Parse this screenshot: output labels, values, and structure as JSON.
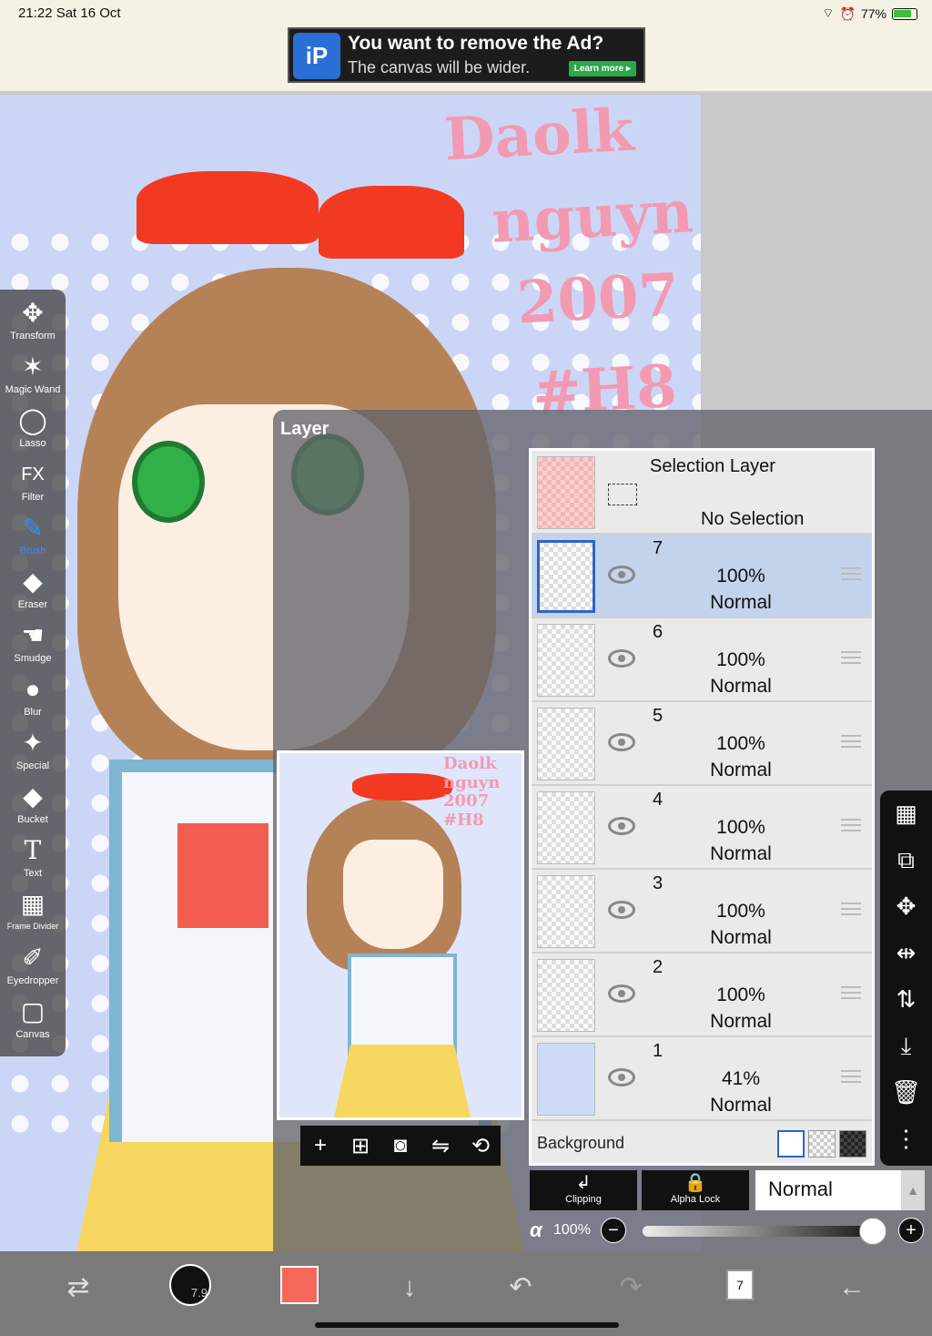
{
  "status_bar": {
    "time_date": "21:22  Sat 16 Oct",
    "battery": "77%"
  },
  "ad": {
    "logo": "iP",
    "headline": "You want to remove the Ad?",
    "subline": "The canvas will be wider.",
    "button": "Learn more ▸"
  },
  "canvas": {
    "signature": [
      "Daolk",
      "nguyn",
      "2007",
      "#H8"
    ]
  },
  "toolbar": {
    "tools": [
      {
        "label": "Transform",
        "icon": "✥"
      },
      {
        "label": "Magic Wand",
        "icon": "✶"
      },
      {
        "label": "Lasso",
        "icon": "◯"
      },
      {
        "label": "Filter",
        "icon": "FX"
      },
      {
        "label": "Brush",
        "icon": "✎"
      },
      {
        "label": "Eraser",
        "icon": "◆"
      },
      {
        "label": "Smudge",
        "icon": "☚"
      },
      {
        "label": "Blur",
        "icon": "●"
      },
      {
        "label": "Special",
        "icon": "✦"
      },
      {
        "label": "Bucket",
        "icon": "◆"
      },
      {
        "label": "Text",
        "icon": "T"
      },
      {
        "label": "Frame Divider",
        "icon": "▦"
      },
      {
        "label": "Eyedropper",
        "icon": "✐"
      },
      {
        "label": "Canvas",
        "icon": "▢"
      }
    ],
    "active": "Brush"
  },
  "layer_panel": {
    "title": "Layer",
    "selection_layer": {
      "name": "Selection Layer",
      "status": "No Selection"
    },
    "layers": [
      {
        "number": "7",
        "opacity": "100%",
        "mode": "Normal",
        "selected": true
      },
      {
        "number": "6",
        "opacity": "100%",
        "mode": "Normal",
        "selected": false
      },
      {
        "number": "5",
        "opacity": "100%",
        "mode": "Normal",
        "selected": false
      },
      {
        "number": "4",
        "opacity": "100%",
        "mode": "Normal",
        "selected": false
      },
      {
        "number": "3",
        "opacity": "100%",
        "mode": "Normal",
        "selected": false
      },
      {
        "number": "2",
        "opacity": "100%",
        "mode": "Normal",
        "selected": false
      },
      {
        "number": "1",
        "opacity": "41%",
        "mode": "Normal",
        "selected": false
      }
    ],
    "background_label": "Background",
    "background_swatches": [
      "white",
      "checker",
      "dark-checker"
    ],
    "preview_actions": [
      {
        "name": "add-layer-button",
        "icon": "+"
      },
      {
        "name": "add-raster-layer-button",
        "icon": "⊞"
      },
      {
        "name": "camera-button",
        "icon": "◙"
      },
      {
        "name": "flip-button",
        "icon": "⇋"
      },
      {
        "name": "rotate-button",
        "icon": "⟲"
      }
    ],
    "side_actions": [
      {
        "name": "checker-button",
        "icon": "▦"
      },
      {
        "name": "layer-transform-button",
        "icon": "⧉"
      },
      {
        "name": "move-button",
        "icon": "✥"
      },
      {
        "name": "flip-horizontal-button",
        "icon": "⇹"
      },
      {
        "name": "flip-vertical-button",
        "icon": "⇅"
      },
      {
        "name": "merge-down-button",
        "icon": "⤓"
      },
      {
        "name": "delete-layer-button",
        "icon": "🗑"
      },
      {
        "name": "more-button",
        "icon": "⋮"
      }
    ],
    "clipping": "Clipping",
    "alpha_lock": "Alpha Lock",
    "blend_mode": "Normal",
    "alpha_symbol": "α",
    "opacity": "100%",
    "opacity_value": 1.0
  },
  "bottom_bar": {
    "brush_size": "7.9",
    "layer_count": "7",
    "color": "#f4685a"
  }
}
